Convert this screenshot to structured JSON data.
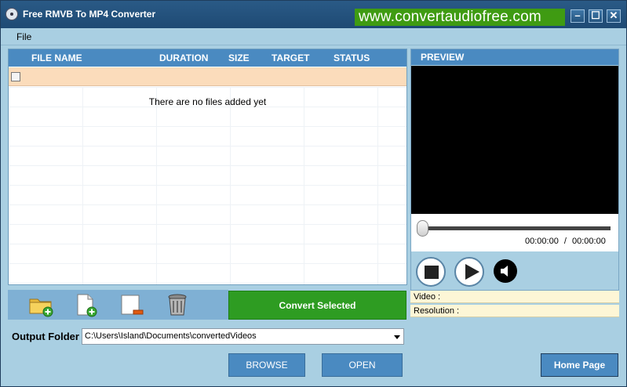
{
  "window": {
    "title": "Free RMVB To MP4 Converter",
    "website": "www.convertaudiofree.com",
    "controls": {
      "minimize": "–",
      "maximize": "☐",
      "close": "✕"
    }
  },
  "menu": {
    "file": "File"
  },
  "file_list": {
    "columns": [
      "FILE NAME",
      "DURATION",
      "SIZE",
      "TARGET",
      "STATUS"
    ],
    "empty_message": "There are no files added yet"
  },
  "toolbar": {
    "icons": [
      "add-folder-icon",
      "add-file-icon",
      "remove-file-icon",
      "trash-icon"
    ]
  },
  "convert": {
    "label": "Convert Selected"
  },
  "output": {
    "label": "Output Folder",
    "path": "C:\\Users\\Island\\Documents\\convertedVideos"
  },
  "buttons": {
    "browse": "BROWSE",
    "open": "OPEN",
    "home": "Home Page"
  },
  "preview": {
    "title": "PREVIEW",
    "time_current": "00:00:00",
    "time_separator": "/",
    "time_total": "00:00:00",
    "video_label": "Video :",
    "resolution_label": "Resolution :"
  },
  "colors": {
    "accent": "#4a8ac1",
    "convert_green": "#2e9c22",
    "website_green": "#3f9b12",
    "window_bg": "#a9cfe2"
  }
}
